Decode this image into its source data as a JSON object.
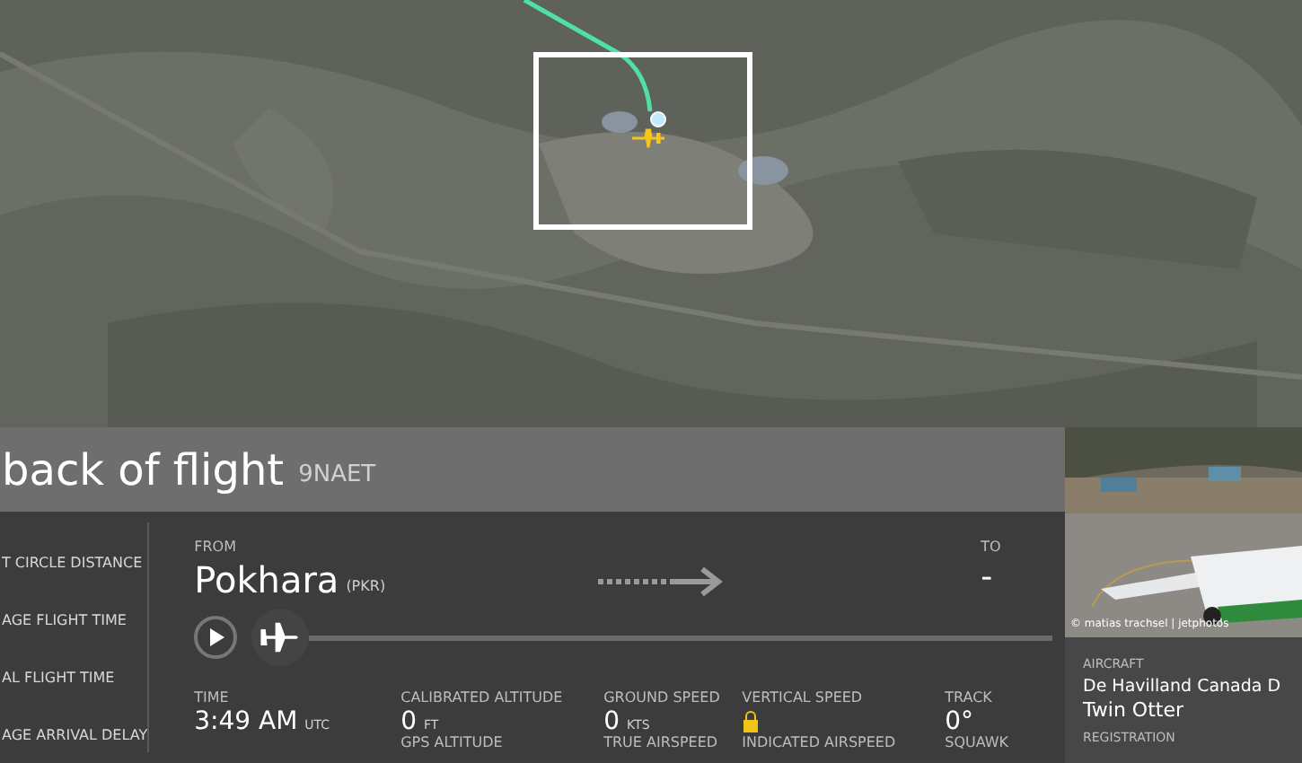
{
  "map": {
    "kind": "picture"
  },
  "header": {
    "title": "back of flight",
    "flight": "9NAET"
  },
  "summary_labels": [
    "T CIRCLE DISTANCE",
    "AGE FLIGHT TIME",
    "AL FLIGHT TIME",
    "AGE ARRIVAL DELAY"
  ],
  "route": {
    "from_label": "FROM",
    "from_city": "Pokhara",
    "from_code": "(PKR)",
    "to_label": "TO",
    "to_city": "-"
  },
  "playback": {
    "level": 0.0
  },
  "stats": [
    {
      "label": "TIME",
      "value": "3:49 AM",
      "unit": "UTC",
      "kind": "text"
    },
    {
      "label": "CALIBRATED ALTITUDE",
      "value": "0",
      "unit": "FT",
      "kind": "text"
    },
    {
      "label": "GROUND SPEED",
      "value": "0",
      "unit": "KTS",
      "kind": "text"
    },
    {
      "label": "VERTICAL SPEED",
      "kind": "locked"
    },
    {
      "label": "TRACK",
      "value": "0°",
      "kind": "text"
    }
  ],
  "stats_next": [
    "GPS ALTITUDE",
    "TRUE AIRSPEED",
    "INDICATED AIRSPEED",
    "SQUAWK"
  ],
  "photo": {
    "kind": "picture",
    "credit": "© matias trachsel | jetphotos"
  },
  "aircraft": {
    "label": "AIRCRAFT",
    "model": "De Havilland Canada D",
    "model_line2": "Twin Otter",
    "registration_label": "REGISTRATION"
  }
}
